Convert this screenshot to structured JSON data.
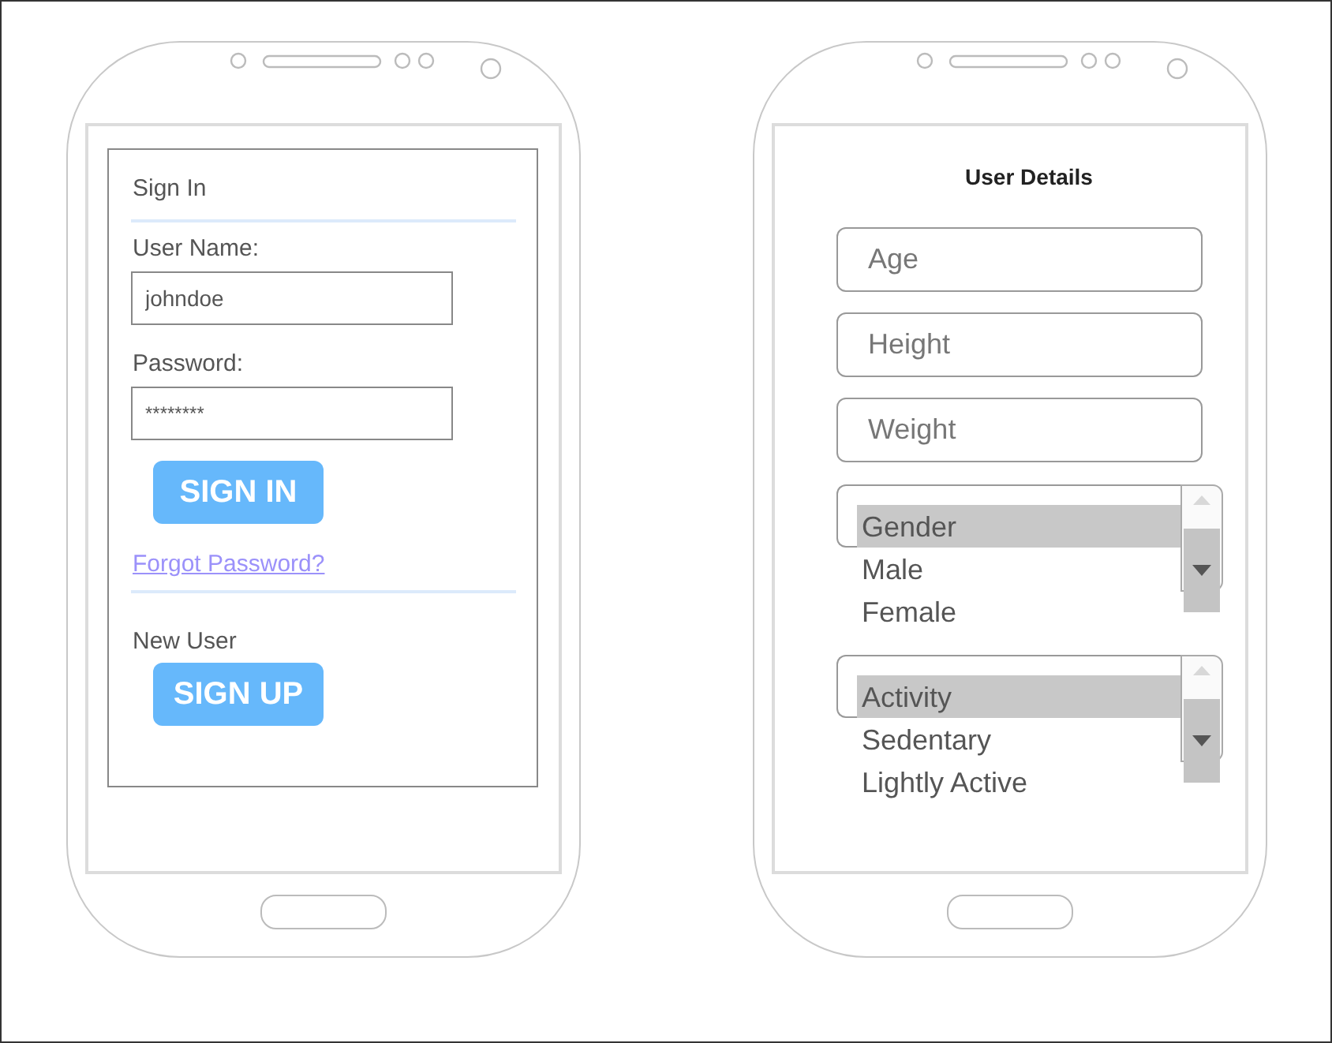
{
  "sign_in_screen": {
    "heading": "Sign In",
    "fields": [
      {
        "label": "User Name:",
        "value": "johndoe"
      },
      {
        "label": "Password:",
        "value": "********"
      }
    ],
    "sign_in_button": "SIGN IN",
    "forgot_link": "Forgot Password?",
    "new_user_label": "New User",
    "sign_up_button": "SIGN UP"
  },
  "user_details_screen": {
    "title": "User Details",
    "fields": [
      {
        "placeholder": "Age"
      },
      {
        "placeholder": "Height"
      },
      {
        "placeholder": "Weight"
      }
    ],
    "listboxes": [
      {
        "items": [
          {
            "label": "Gender",
            "selected": true
          },
          {
            "label": "Male",
            "selected": false
          },
          {
            "label": "Female",
            "selected": false
          }
        ]
      },
      {
        "items": [
          {
            "label": "Activity",
            "selected": true
          },
          {
            "label": "Sedentary",
            "selected": false
          },
          {
            "label": "Lightly Active",
            "selected": false
          }
        ]
      }
    ]
  }
}
